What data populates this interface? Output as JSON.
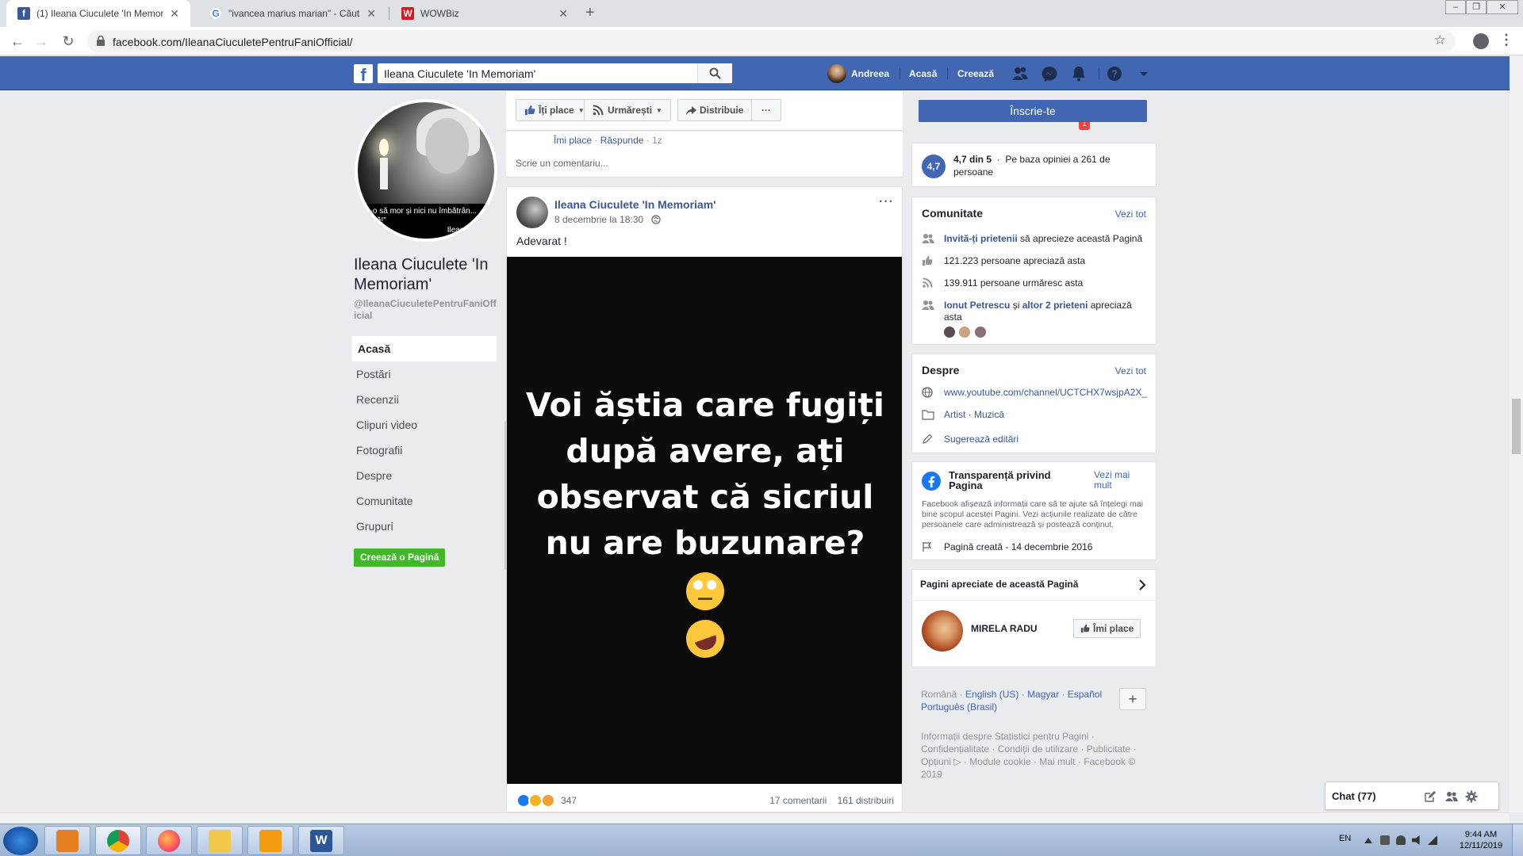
{
  "browser": {
    "tabs": [
      {
        "title": "(1) Ileana Ciuculete 'In Memoriam'",
        "favicon": "facebook-icon",
        "active": true
      },
      {
        "title": "\"ivancea marius marian\" - Căutare",
        "favicon": "google-icon",
        "active": false
      },
      {
        "title": "WOWBiz",
        "favicon": "wowbiz-icon",
        "active": false
      }
    ],
    "new_tab": "+",
    "url": "facebook.com/IleanaCiuculetePentruFaniOfficial/"
  },
  "fb_header": {
    "search_value": "Ileana Ciuculete 'In Memoriam'",
    "user_name": "Andreea",
    "home": "Acasă",
    "create": "Creează",
    "notification_count": "1"
  },
  "left": {
    "page_name": "Ileana Ciuculete 'In Memoriam'",
    "handle": "@IleanaCiuculetePentruFaniOfficial",
    "profile_caption": "n-o să mor și nici nu îmbătrân... dată!\"",
    "profile_caption_sig": "Ileana",
    "nav": [
      "Acasă",
      "Postări",
      "Recenzii",
      "Clipuri video",
      "Fotografii",
      "Despre",
      "Comunitate",
      "Grupuri"
    ],
    "create_page": "Creează o Pagină"
  },
  "actions": {
    "like": "Îți place",
    "follow": "Urmărești",
    "share": "Distribuie",
    "more": "···"
  },
  "comment": {
    "like": "Îmi place",
    "reply": "Răspunde",
    "time": "1z",
    "write_placeholder": "Scrie un comentariu..."
  },
  "post": {
    "author": "Ileana Ciuculete 'In Memoriam'",
    "date": "8 decembrie la 18:30",
    "text": "Adevarat !",
    "image_text": "Voi ăștia care fugiți după avere, ați observat că sicriul nu are buzunare?",
    "reactions_count": "347",
    "comments": "17 comentarii",
    "shares": "161 distribuiri",
    "more": "···"
  },
  "right": {
    "signup": "Înscrie-te",
    "rating": {
      "badge": "4,7",
      "score": "4,7 din 5",
      "text": "Pe baza opiniei a 261 de persoane"
    },
    "community": {
      "title": "Comunitate",
      "see_all": "Vezi tot",
      "invite_link": "Invită-ți prietenii",
      "invite_rest": "să aprecieze această Pagină",
      "likes": "121.223 persoane apreciază asta",
      "follows": "139.911 persoane urmăresc asta",
      "friend_name": "Ionut Petrescu",
      "friend_and": "și",
      "friend_others": "altor 2 prieteni",
      "friend_rest": "apreciază asta"
    },
    "about": {
      "title": "Despre",
      "see_all": "Vezi tot",
      "website": "www.youtube.com/channel/UCTCHX7wsjpA2X_",
      "category_1": "Artist",
      "category_2": "Muzică",
      "suggest": "Sugerează editări"
    },
    "transparency": {
      "title": "Transparență privind Pagina",
      "more": "Vezi mai mult",
      "desc": "Facebook afișează informații care să te ajute să înțelegi mai bine scopul acestei Pagini. Vezi acțiunile realizate de către persoanele care administrează și postează conținut.",
      "created": "Pagină creată - 14 decembrie 2016"
    },
    "liked_pages": {
      "title": "Pagini apreciate de această Pagină",
      "page_name": "MIRELA RADU",
      "like_btn": "Îmi place"
    },
    "languages": {
      "current": "Română",
      "others": [
        "English (US)",
        "Magyar",
        "Español",
        "Português (Brasil)"
      ]
    },
    "footer": "Informații despre Statistici pentru Pagini · Confidențialitate · Condiții de utilizare · Publicitate · Opțiuni ▷ · Module cookie · Mai mult · Facebook © 2019"
  },
  "chat": {
    "label": "Chat (77)"
  },
  "taskbar": {
    "lang": "EN",
    "time": "9:44 AM",
    "date": "12/11/2019"
  },
  "colors": {
    "fb_blue": "#4267b2",
    "link": "#385898",
    "green": "#42b72a"
  }
}
